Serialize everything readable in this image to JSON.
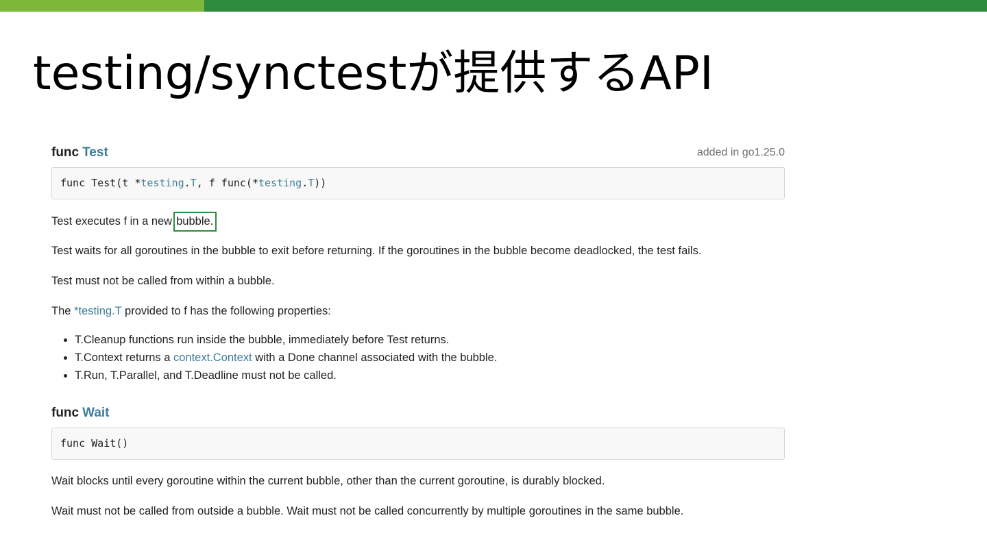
{
  "slide": {
    "title": "testing/synctestが提供するAPI",
    "accent_colors": [
      "#7cb83a",
      "#2e8b3e"
    ]
  },
  "funcs": [
    {
      "keyword": "func",
      "name": "Test",
      "version": "added in go1.25.0",
      "signature": {
        "p1": "func Test(t *",
        "t1": "testing",
        "d1": ".",
        "t2": "T",
        "p2": ", f func(*",
        "t3": "testing",
        "d2": ".",
        "t4": "T",
        "p3": "))"
      },
      "para1_prefix": "Test executes f in a new",
      "para1_highlight": "bubble.",
      "para2": "Test waits for all goroutines in the bubble to exit before returning. If the goroutines in the bubble become deadlocked, the test fails.",
      "para3": "Test must not be called from within a bubble.",
      "para4_before": "The",
      "para4_link": "*testing.T",
      "para4_after": "provided to f has the following properties:",
      "bullets": {
        "b1": "T.Cleanup functions run inside the bubble, immediately before Test returns.",
        "b2_before": "T.Context returns a",
        "b2_link": "context.Context",
        "b2_after": "with a Done channel associated with the bubble.",
        "b3": "T.Run, T.Parallel, and T.Deadline must not be called."
      }
    },
    {
      "keyword": "func",
      "name": "Wait",
      "signature": "func Wait()",
      "para1": "Wait blocks until every goroutine within the current bubble, other than the current goroutine, is durably blocked.",
      "para2": "Wait must not be called from outside a bubble. Wait must not be called concurrently by multiple goroutines in the same bubble."
    }
  ]
}
